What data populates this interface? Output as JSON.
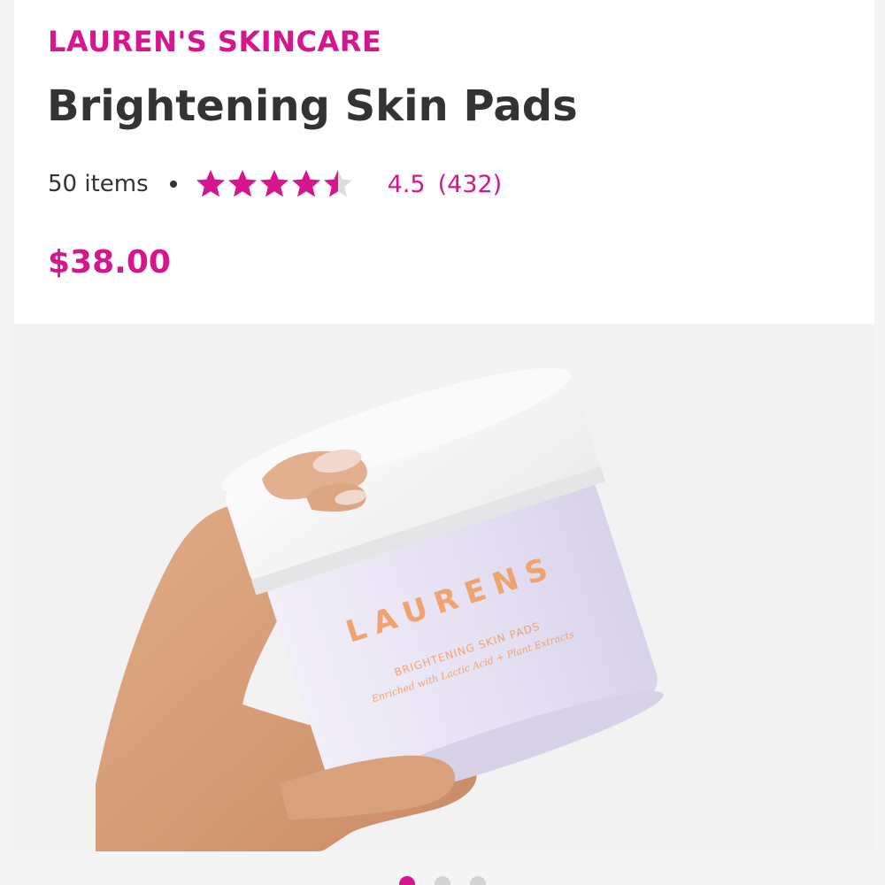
{
  "product": {
    "brand": "LAUREN'S SKINCARE",
    "name": "Brightening Skin Pads",
    "item_count": "50 items",
    "rating_value": 4.5,
    "rating_label": "4.5",
    "review_count": "(432)",
    "stars_total": 5,
    "price": "$38.00"
  },
  "image": {
    "subject": "hand holding jar",
    "jar_logo": "LAURENS",
    "jar_product_line": "BRIGHTENING SKIN PADS",
    "jar_tagline": "Enriched with Lactic Acid + Plant Extracts"
  },
  "carousel": {
    "total": 3,
    "active_index": 0
  },
  "colors": {
    "accent": "#d6168f",
    "text": "#333333",
    "star_empty": "#dcdcdc",
    "jar_lettering": "#f0a36e"
  }
}
